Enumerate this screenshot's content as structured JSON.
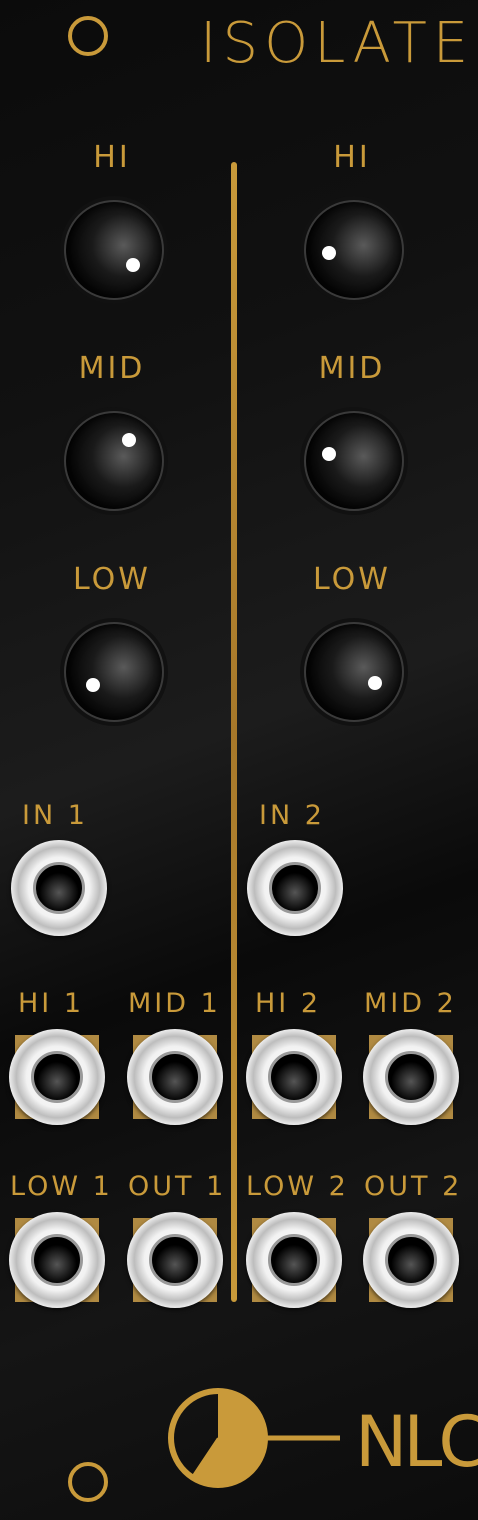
{
  "module": {
    "title": "ISOLATE",
    "brand": "NLC",
    "accent_color": "#c99a3a"
  },
  "channel1": {
    "knobs": [
      {
        "label": "HI"
      },
      {
        "label": "MID"
      },
      {
        "label": "LOW"
      }
    ],
    "input_label": "IN 1",
    "outputs": [
      {
        "label": "HI 1"
      },
      {
        "label": "MID 1"
      },
      {
        "label": "LOW 1"
      },
      {
        "label": "OUT 1"
      }
    ]
  },
  "channel2": {
    "knobs": [
      {
        "label": "HI"
      },
      {
        "label": "MID"
      },
      {
        "label": "LOW"
      }
    ],
    "input_label": "IN 2",
    "outputs": [
      {
        "label": "HI 2"
      },
      {
        "label": "MID 2"
      },
      {
        "label": "LOW 2"
      },
      {
        "label": "OUT 2"
      }
    ]
  }
}
